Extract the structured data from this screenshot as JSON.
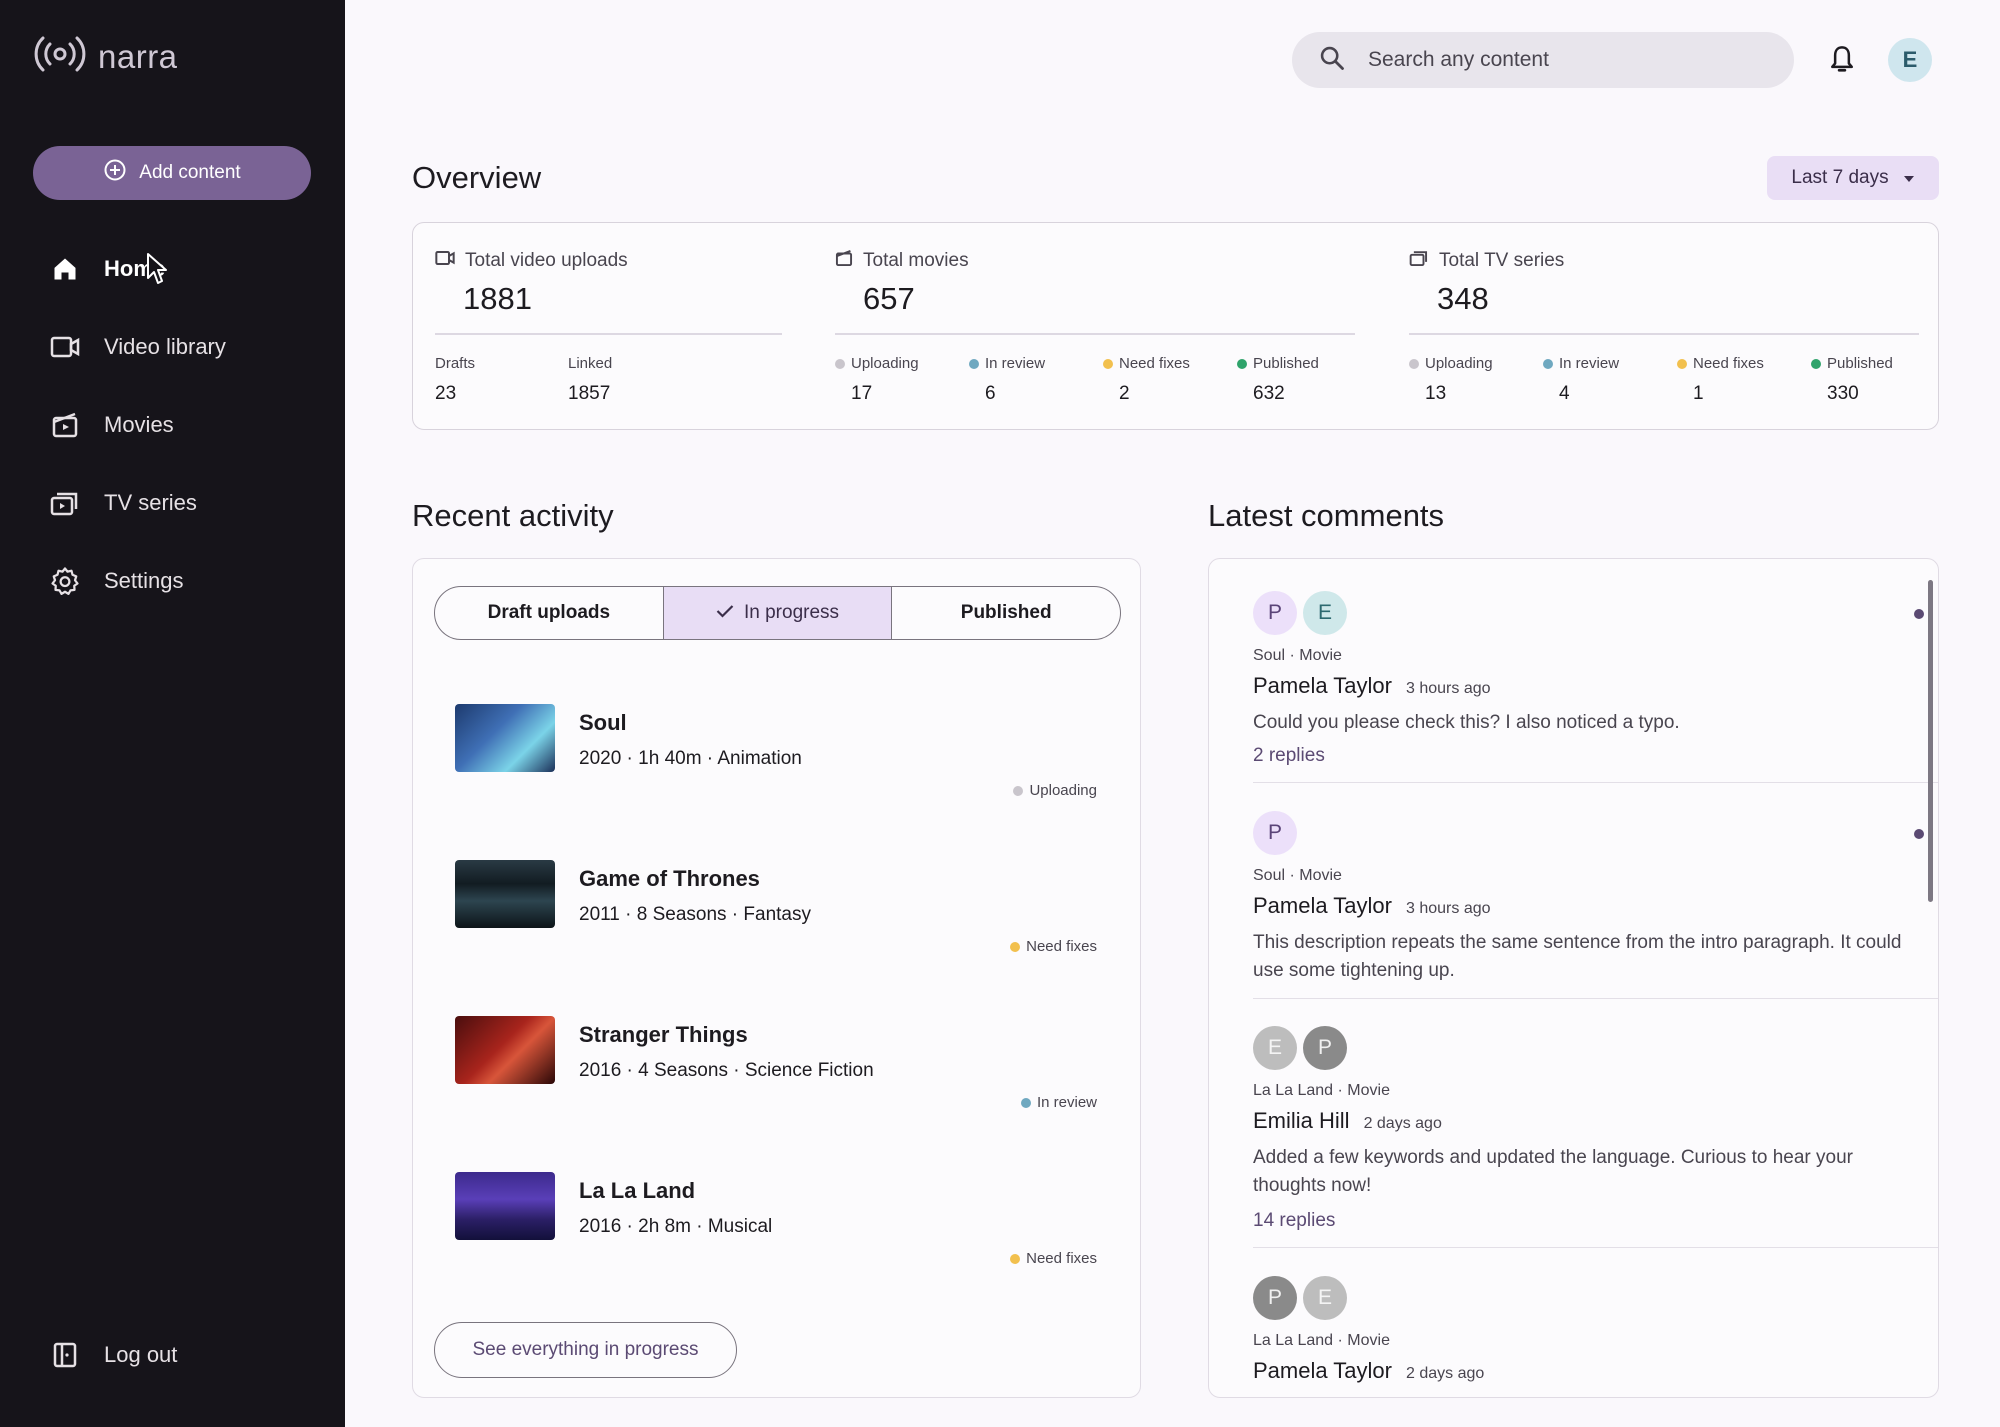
{
  "brand": {
    "name": "narra"
  },
  "sidebar": {
    "add_label": "Add content",
    "items": [
      {
        "label": "Home",
        "icon": "home-icon"
      },
      {
        "label": "Video library",
        "icon": "video-icon"
      },
      {
        "label": "Movies",
        "icon": "movie-icon"
      },
      {
        "label": "TV series",
        "icon": "tv-icon"
      },
      {
        "label": "Settings",
        "icon": "gear-icon"
      }
    ],
    "logout_label": "Log out"
  },
  "header": {
    "search_placeholder": "Search any content",
    "avatar_initial": "E"
  },
  "overview": {
    "title": "Overview",
    "range": "Last 7 days",
    "uploads": {
      "label": "Total video uploads",
      "value": "1881",
      "drafts_label": "Drafts",
      "drafts": "23",
      "linked_label": "Linked",
      "linked": "1857"
    },
    "movies": {
      "label": "Total movies",
      "value": "657",
      "uploading": "17",
      "in_review": "6",
      "need_fixes": "2",
      "published": "632"
    },
    "tv": {
      "label": "Total TV series",
      "value": "348",
      "uploading": "13",
      "in_review": "4",
      "need_fixes": "1",
      "published": "330"
    },
    "status_labels": {
      "uploading": "Uploading",
      "in_review": "In review",
      "need_fixes": "Need fixes",
      "published": "Published"
    },
    "status_colors": {
      "uploading": "#c9c5cc",
      "in_review": "#6fa8c0",
      "need_fixes": "#f2c04e",
      "published": "#2fa36b"
    }
  },
  "activity": {
    "title": "Recent activity",
    "tabs": [
      "Draft uploads",
      "In progress",
      "Published"
    ],
    "selected_tab": "In progress",
    "items": [
      {
        "title": "Soul",
        "meta": "2020 · 1h 40m · Animation",
        "status": "Uploading"
      },
      {
        "title": "Game of Thrones",
        "meta": "2011 · 8 Seasons · Fantasy",
        "status": "Need fixes"
      },
      {
        "title": "Stranger Things",
        "meta": "2016 · 4 Seasons · Science Fiction",
        "status": "In review"
      },
      {
        "title": "La La Land",
        "meta": "2016 · 2h 8m · Musical",
        "status": "Need fixes"
      }
    ],
    "see_all": "See everything in progress"
  },
  "comments": {
    "title": "Latest comments",
    "items": [
      {
        "avatars": [
          "P",
          "E"
        ],
        "source": "Soul · Movie",
        "author": "Pamela Taylor",
        "time": "3 hours ago",
        "text": "Could you please check this? I also noticed a typo.",
        "replies": "2 replies",
        "unread": true
      },
      {
        "avatars": [
          "P"
        ],
        "source": "Soul · Movie",
        "author": "Pamela Taylor",
        "time": "3 hours ago",
        "text": "This description repeats the same sentence from the intro paragraph. It could use some tightening up.",
        "replies": "",
        "unread": true
      },
      {
        "avatars": [
          "E",
          "P"
        ],
        "source": "La La Land · Movie",
        "author": "Emilia Hill",
        "time": "2 days ago",
        "text": "Added a few keywords and updated the language. Curious to hear your thoughts now!",
        "replies": "14 replies",
        "unread": false
      },
      {
        "avatars": [
          "P",
          "E"
        ],
        "source": "La La Land · Movie",
        "author": "Pamela Taylor",
        "time": "2 days ago",
        "text": "",
        "replies": "",
        "unread": false
      }
    ]
  }
}
